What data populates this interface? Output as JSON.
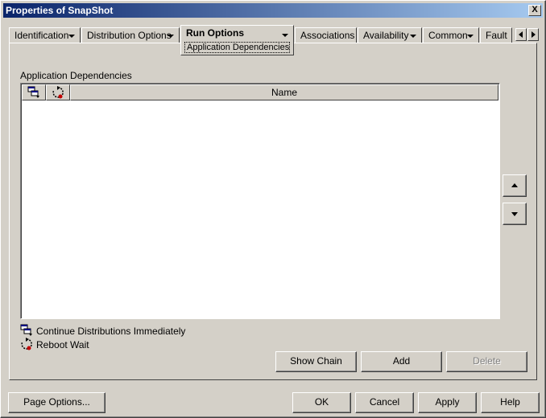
{
  "window": {
    "title": "Properties of SnapShot",
    "close_label": "X"
  },
  "tabs": [
    {
      "label": "Identification",
      "has_menu": true
    },
    {
      "label": "Distribution Options",
      "has_menu": true
    },
    {
      "label": "Run Options",
      "has_menu": true,
      "active": true,
      "subpage": "Application Dependencies"
    },
    {
      "label": "Associations",
      "has_menu": false
    },
    {
      "label": "Availability",
      "has_menu": true
    },
    {
      "label": "Common",
      "has_menu": true
    },
    {
      "label": "Fault",
      "has_menu": false
    }
  ],
  "section": {
    "title": "Application Dependencies"
  },
  "table": {
    "columns": [
      {
        "key": "continue",
        "icon": "continue-distribution-icon"
      },
      {
        "key": "reboot",
        "icon": "reboot-wait-icon"
      },
      {
        "key": "name",
        "label": "Name"
      }
    ],
    "rows": []
  },
  "legend": {
    "continue_label": "Continue Distributions Immediately",
    "reboot_label": "Reboot Wait"
  },
  "actions": {
    "show_chain": "Show Chain",
    "add": "Add",
    "delete": "Delete"
  },
  "footer": {
    "page_options": "Page Options...",
    "ok": "OK",
    "cancel": "Cancel",
    "apply": "Apply",
    "help": "Help"
  },
  "colors": {
    "face": "#d4d0c8",
    "title_start": "#0a246a",
    "title_end": "#a6caf0",
    "list_bg": "#ffffff"
  }
}
